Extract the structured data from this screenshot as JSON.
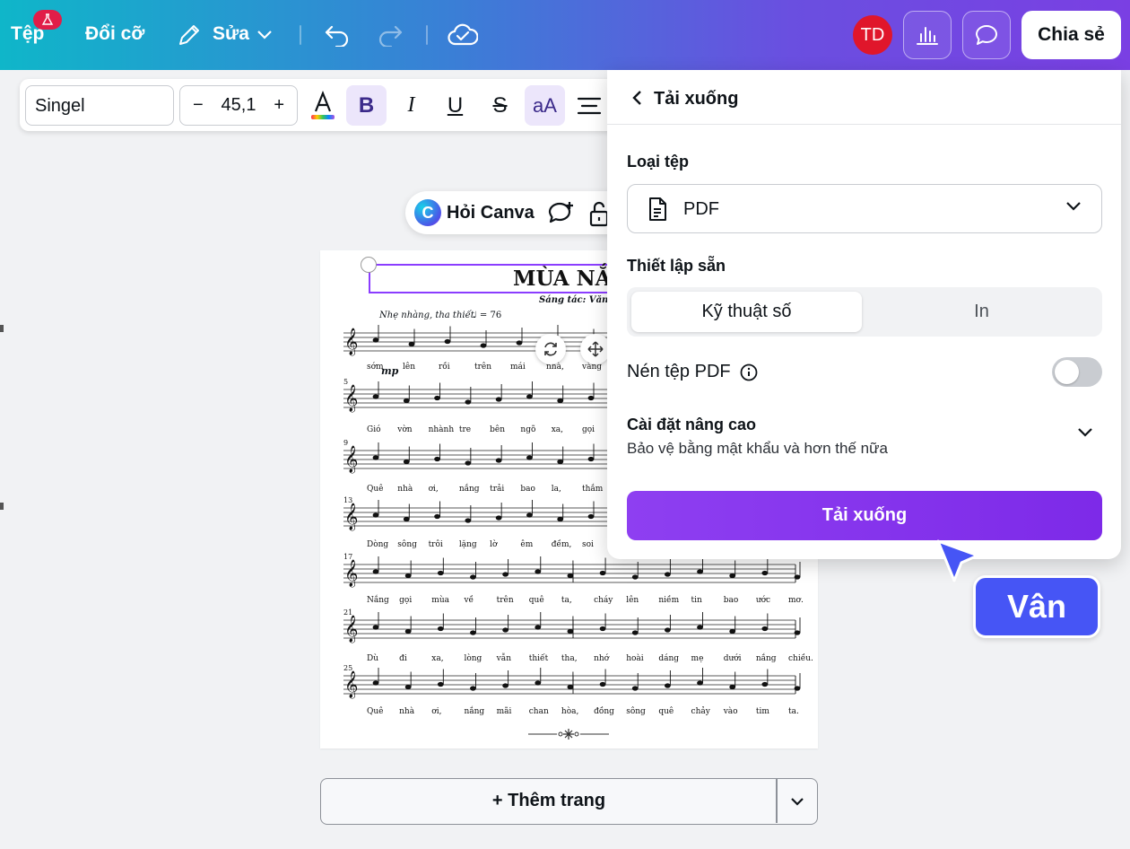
{
  "topbar": {
    "file_label": "Tệp",
    "resize_label": "Đổi cỡ",
    "edit_label": "Sửa",
    "avatar_initials": "TD",
    "share_label": "Chia sẻ",
    "accent_gradient": [
      "#0fb6c9",
      "#7a3fe3"
    ]
  },
  "format_toolbar": {
    "font_name": "Singel",
    "font_size": "45,1",
    "decrease": "−",
    "increase": "+",
    "case_label": "aA"
  },
  "ask_canva": {
    "label": "Hỏi Canva"
  },
  "sheet": {
    "title": "MÙA NẮNG",
    "composer": "Sáng tác: Văn La",
    "tempo_text": "Nhẹ nhàng, tha thiết",
    "tempo_mark": "♩ = 76",
    "dynamic": "mp",
    "systems": [
      {
        "measure": "",
        "lyrics": [
          "sớm",
          "lên",
          "rồi",
          "trên",
          "mái",
          "nhà,",
          "vàng"
        ]
      },
      {
        "measure": "5",
        "lyrics": [
          "Gió",
          "vờn",
          "nhành",
          "tre",
          "bên",
          "ngõ",
          "xa,",
          "gọi"
        ]
      },
      {
        "measure": "9",
        "lyrics": [
          "Quê",
          "nhà",
          "ơi,",
          "nắng",
          "trải",
          "bao",
          "la,",
          "thắm"
        ]
      },
      {
        "measure": "13",
        "lyrics": [
          "Dòng",
          "sông",
          "trôi",
          "lặng",
          "lờ",
          "êm",
          "đềm,",
          "soi"
        ]
      },
      {
        "measure": "17",
        "lyrics": [
          "Nắng",
          "gọi",
          "mùa",
          "về",
          "trên",
          "quê",
          "ta,",
          "cháy",
          "lên",
          "niềm",
          "tin",
          "bao",
          "ước",
          "mơ."
        ]
      },
      {
        "measure": "21",
        "lyrics": [
          "Dù",
          "đi",
          "xa,",
          "lòng",
          "vẫn",
          "thiết",
          "tha,",
          "nhớ",
          "hoài",
          "dáng",
          "mẹ",
          "dưới",
          "nắng",
          "chiều."
        ]
      },
      {
        "measure": "25",
        "lyrics": [
          "Quê",
          "nhà",
          "ơi,",
          "nắng",
          "mãi",
          "chan",
          "hòa,",
          "đồng",
          "sông",
          "quê",
          "chảy",
          "vào",
          "tim",
          "ta."
        ]
      }
    ]
  },
  "add_page": {
    "label": "+ Thêm trang"
  },
  "download_panel": {
    "title": "Tải xuống",
    "file_type_label": "Loại tệp",
    "file_type_value": "PDF",
    "preset_label": "Thiết lập sẵn",
    "preset_options": [
      "Kỹ thuật số",
      "In"
    ],
    "preset_selected": "Kỹ thuật số",
    "compress_label": "Nén tệp PDF",
    "compress_enabled": false,
    "advanced_title": "Cài đặt nâng cao",
    "advanced_subtitle": "Bảo vệ bằng mật khẩu và hơn thế nữa",
    "download_button": "Tải xuống",
    "button_color": "#8b3dff"
  },
  "collaborator": {
    "name": "Vân",
    "color": "#4655f5"
  }
}
